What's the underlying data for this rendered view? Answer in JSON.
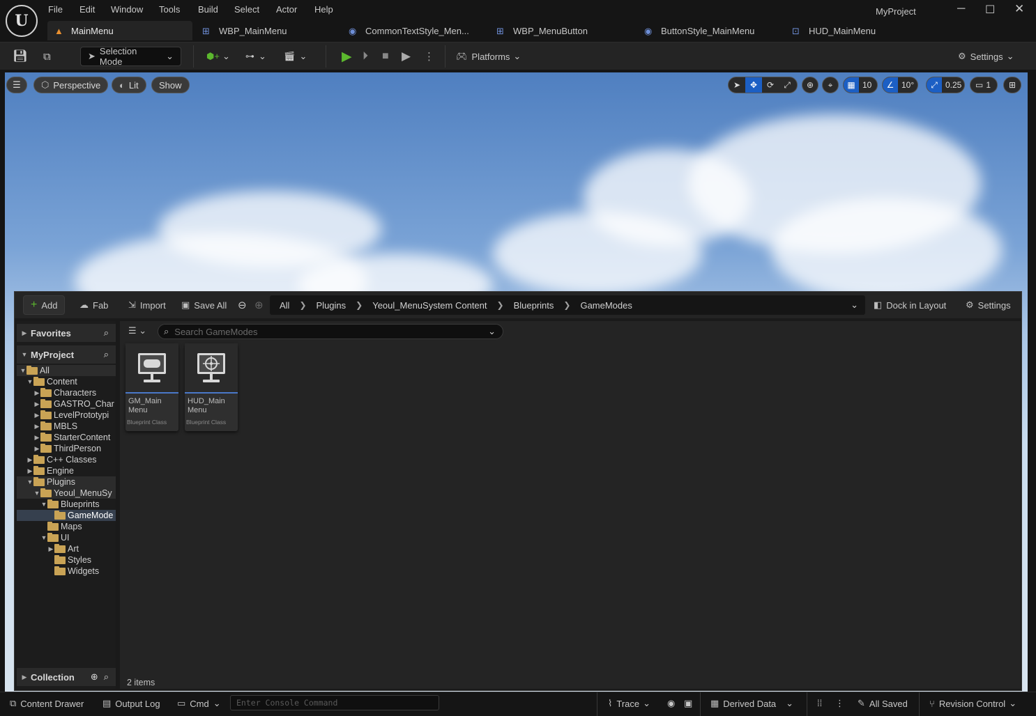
{
  "menu": [
    "File",
    "Edit",
    "Window",
    "Tools",
    "Build",
    "Select",
    "Actor",
    "Help"
  ],
  "project_name": "MyProject",
  "tabs": [
    {
      "label": "MainMenu",
      "active": true
    },
    {
      "label": "WBP_MainMenu"
    },
    {
      "label": "CommonTextStyle_Men..."
    },
    {
      "label": "WBP_MenuButton"
    },
    {
      "label": "ButtonStyle_MainMenu"
    },
    {
      "label": "HUD_MainMenu"
    }
  ],
  "toolbar": {
    "selection_mode": "Selection Mode",
    "platforms": "Platforms",
    "settings": "Settings"
  },
  "viewport": {
    "perspective": "Perspective",
    "lit": "Lit",
    "show": "Show",
    "grid_size": "10",
    "rotation_snap": "10°",
    "scale_snap": "0.25",
    "camera_speed": "1"
  },
  "drawer": {
    "add": "Add",
    "fab": "Fab",
    "import": "Import",
    "save_all": "Save All",
    "breadcrumb": [
      "All",
      "Plugins",
      "Yeoul_MenuSystem Content",
      "Blueprints",
      "GameModes"
    ],
    "dock_in_layout": "Dock in Layout",
    "settings": "Settings",
    "favorites": "Favorites",
    "project": "MyProject",
    "collection": "Collection",
    "search_placeholder": "Search GameModes",
    "item_count": "2 items",
    "tree": [
      {
        "label": "All",
        "depth": 0,
        "open": true,
        "style": "hl"
      },
      {
        "label": "Content",
        "depth": 1,
        "open": true
      },
      {
        "label": "Characters",
        "depth": 2,
        "closed": true
      },
      {
        "label": "GASTRO_Char",
        "depth": 2,
        "closed": true
      },
      {
        "label": "LevelPrototypi",
        "depth": 2,
        "closed": true
      },
      {
        "label": "MBLS",
        "depth": 2,
        "closed": true
      },
      {
        "label": "StarterContent",
        "depth": 2,
        "closed": true
      },
      {
        "label": "ThirdPerson",
        "depth": 2,
        "closed": true
      },
      {
        "label": "C++ Classes",
        "depth": 1,
        "closed": true
      },
      {
        "label": "Engine",
        "depth": 1,
        "closed": true
      },
      {
        "label": "Plugins",
        "depth": 1,
        "open": true,
        "style": "hl"
      },
      {
        "label": "Yeoul_MenuSy",
        "depth": 2,
        "open": true,
        "style": "hl"
      },
      {
        "label": "Blueprints",
        "depth": 3,
        "open": true
      },
      {
        "label": "GameMode",
        "depth": 4,
        "style": "sel"
      },
      {
        "label": "Maps",
        "depth": 3
      },
      {
        "label": "UI",
        "depth": 3,
        "open": true
      },
      {
        "label": "Art",
        "depth": 4,
        "closed": true
      },
      {
        "label": "Styles",
        "depth": 4
      },
      {
        "label": "Widgets",
        "depth": 4
      }
    ],
    "assets": [
      {
        "name": "GM_Main Menu",
        "type": "Blueprint Class",
        "icon": "gamepad-monitor-icon"
      },
      {
        "name": "HUD_Main Menu",
        "type": "Blueprint Class",
        "icon": "crosshair-monitor-icon"
      }
    ]
  },
  "status": {
    "content_drawer": "Content Drawer",
    "output_log": "Output Log",
    "cmd": "Cmd",
    "console_placeholder": "Enter Console Command",
    "trace": "Trace",
    "derived_data": "Derived Data",
    "all_saved": "All Saved",
    "revision_control": "Revision Control"
  },
  "colors": {
    "accent": "#4a78c8",
    "play": "#5cb82e",
    "folder": "#c9a355"
  }
}
